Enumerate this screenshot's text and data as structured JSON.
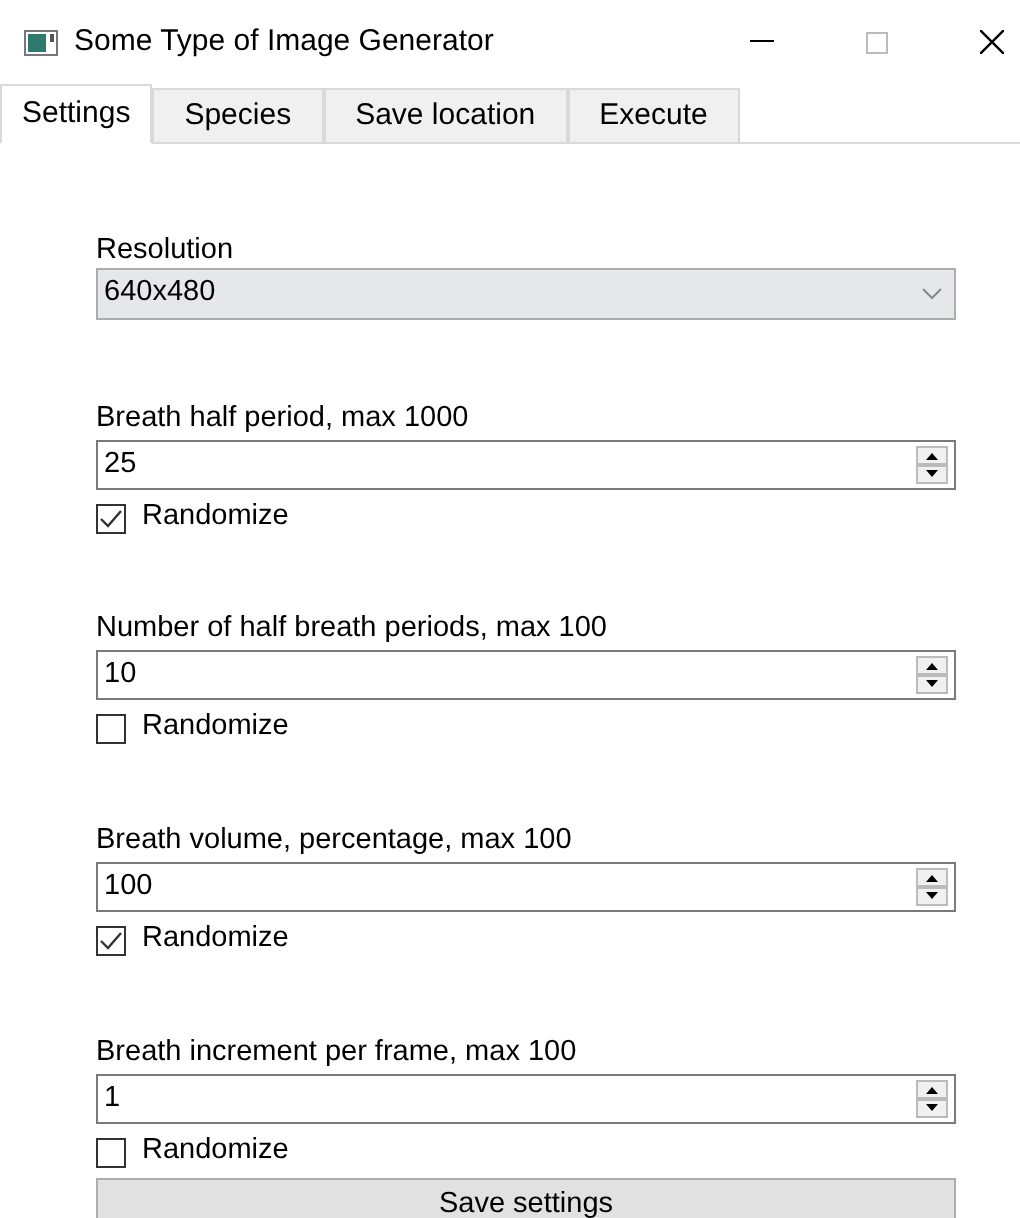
{
  "window": {
    "title": "Some Type of Image Generator"
  },
  "tabs": [
    {
      "label": "Settings",
      "selected": true
    },
    {
      "label": "Species",
      "selected": false
    },
    {
      "label": "Save location",
      "selected": false
    },
    {
      "label": "Execute",
      "selected": false
    }
  ],
  "resolution": {
    "label": "Resolution",
    "value": "640x480"
  },
  "fields": [
    {
      "label": "Breath half period, max 1000",
      "value": "25",
      "randomize": {
        "label": "Randomize",
        "checked": true
      }
    },
    {
      "label": "Number of half breath periods, max 100",
      "value": "10",
      "randomize": {
        "label": "Randomize",
        "checked": false
      }
    },
    {
      "label": "Breath volume, percentage, max 100",
      "value": "100",
      "randomize": {
        "label": "Randomize",
        "checked": true
      }
    },
    {
      "label": "Breath increment per frame, max 100",
      "value": "1",
      "randomize": {
        "label": "Randomize",
        "checked": false
      }
    }
  ],
  "save_button": "Save settings"
}
